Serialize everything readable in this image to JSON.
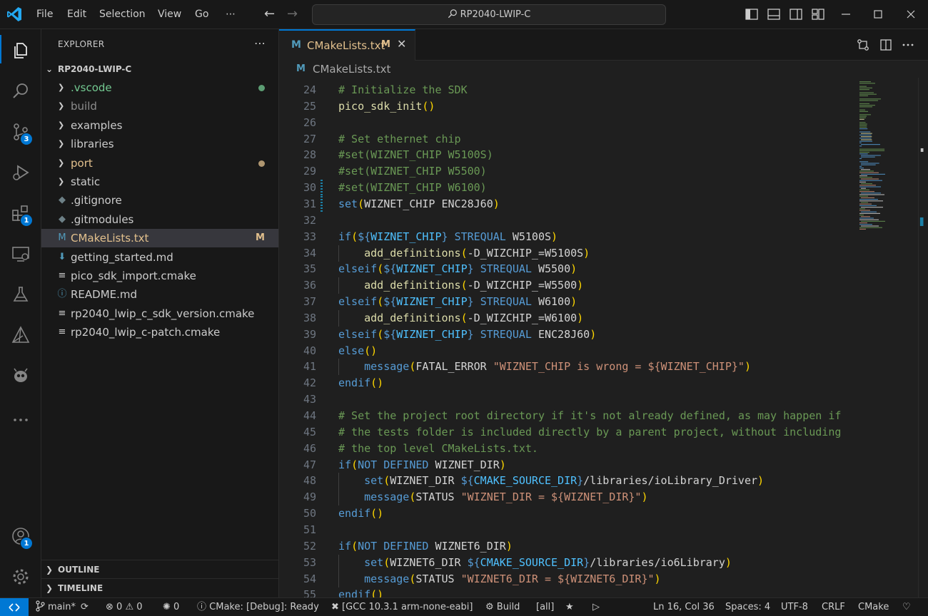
{
  "titlebar": {
    "menus": [
      "File",
      "Edit",
      "Selection",
      "View",
      "Go",
      "⋯"
    ],
    "search_text": "RP2040-LWIP-C",
    "search_icon": "search-icon",
    "accent": "#0078d4"
  },
  "activity_bar": {
    "badges": {
      "source_control": "3",
      "extensions": "1",
      "accounts": "1"
    }
  },
  "sidebar": {
    "title": "EXPLORER",
    "more": "⋯",
    "root": "RP2040-LWIP-C",
    "items": [
      {
        "name": ".vscode",
        "type": "folder",
        "color": "#73c991",
        "status": "dot"
      },
      {
        "name": "build",
        "type": "folder",
        "color": "#8c8c8c",
        "status": ""
      },
      {
        "name": "examples",
        "type": "folder",
        "color": "#cccccc",
        "status": ""
      },
      {
        "name": "libraries",
        "type": "folder",
        "color": "#cccccc",
        "status": ""
      },
      {
        "name": "port",
        "type": "folder",
        "color": "#e2c08d",
        "status": "dot"
      },
      {
        "name": "static",
        "type": "folder",
        "color": "#cccccc",
        "status": ""
      },
      {
        "name": ".gitignore",
        "type": "file",
        "icon": "◆",
        "iconColor": "#6d8086",
        "color": "#cccccc"
      },
      {
        "name": ".gitmodules",
        "type": "file",
        "icon": "◆",
        "iconColor": "#6d8086",
        "color": "#cccccc"
      },
      {
        "name": "CMakeLists.txt",
        "type": "file",
        "icon": "M",
        "iconColor": "#519aba",
        "color": "#e2c08d",
        "mark": "M",
        "selected": true
      },
      {
        "name": "getting_started.md",
        "type": "file",
        "icon": "⬇",
        "iconColor": "#519aba",
        "color": "#cccccc"
      },
      {
        "name": "pico_sdk_import.cmake",
        "type": "file",
        "icon": "≡",
        "iconColor": "#cccccc",
        "color": "#cccccc"
      },
      {
        "name": "README.md",
        "type": "file",
        "icon": "ⓘ",
        "iconColor": "#519aba",
        "color": "#cccccc"
      },
      {
        "name": "rp2040_lwip_c_sdk_version.cmake",
        "type": "file",
        "icon": "≡",
        "iconColor": "#cccccc",
        "color": "#cccccc"
      },
      {
        "name": "rp2040_lwip_c-patch.cmake",
        "type": "file",
        "icon": "≡",
        "iconColor": "#cccccc",
        "color": "#cccccc"
      }
    ],
    "outline": "OUTLINE",
    "timeline": "TIMELINE"
  },
  "editor": {
    "tab": {
      "icon": "M",
      "label": "CMakeLists.txt",
      "modified": "M",
      "close": "✕"
    },
    "breadcrumb": {
      "icon": "M",
      "label": "CMakeLists.txt"
    },
    "current_line": 16,
    "modified_lines": [
      30,
      31
    ],
    "lines": [
      {
        "n": 24,
        "t": [
          [
            "cmt",
            "# Initialize the SDK"
          ]
        ]
      },
      {
        "n": 25,
        "t": [
          [
            "fn",
            "pico_sdk_init"
          ],
          [
            "par",
            "()"
          ]
        ]
      },
      {
        "n": 26,
        "t": []
      },
      {
        "n": 27,
        "t": [
          [
            "cmt",
            "# Set ethernet chip"
          ]
        ]
      },
      {
        "n": 28,
        "t": [
          [
            "cmt",
            "#set(WIZNET_CHIP W5100S)"
          ]
        ]
      },
      {
        "n": 29,
        "t": [
          [
            "cmt",
            "#set(WIZNET_CHIP W5500)"
          ]
        ]
      },
      {
        "n": 30,
        "t": [
          [
            "cmt",
            "#set(WIZNET_CHIP W6100)"
          ]
        ]
      },
      {
        "n": 31,
        "t": [
          [
            "kw",
            "set"
          ],
          [
            "par",
            "("
          ],
          [
            "plain",
            "WIZNET_CHIP ENC28J60"
          ],
          [
            "par",
            ")"
          ]
        ]
      },
      {
        "n": 32,
        "t": []
      },
      {
        "n": 33,
        "t": [
          [
            "kw",
            "if"
          ],
          [
            "par",
            "("
          ],
          [
            "kw",
            "${"
          ],
          [
            "var",
            "WIZNET_CHIP"
          ],
          [
            "kw",
            "}"
          ],
          [
            "plain",
            " "
          ],
          [
            "kw",
            "STREQUAL"
          ],
          [
            "plain",
            " W5100S"
          ],
          [
            "par",
            ")"
          ]
        ]
      },
      {
        "n": 34,
        "i": 1,
        "t": [
          [
            "fn",
            "add_definitions"
          ],
          [
            "par",
            "("
          ],
          [
            "plain",
            "-D_WIZCHIP_=W5100S"
          ],
          [
            "par",
            ")"
          ]
        ]
      },
      {
        "n": 35,
        "t": [
          [
            "kw",
            "elseif"
          ],
          [
            "par",
            "("
          ],
          [
            "kw",
            "${"
          ],
          [
            "var",
            "WIZNET_CHIP"
          ],
          [
            "kw",
            "}"
          ],
          [
            "plain",
            " "
          ],
          [
            "kw",
            "STREQUAL"
          ],
          [
            "plain",
            " W5500"
          ],
          [
            "par",
            ")"
          ]
        ]
      },
      {
        "n": 36,
        "i": 1,
        "t": [
          [
            "fn",
            "add_definitions"
          ],
          [
            "par",
            "("
          ],
          [
            "plain",
            "-D_WIZCHIP_=W5500"
          ],
          [
            "par",
            ")"
          ]
        ]
      },
      {
        "n": 37,
        "t": [
          [
            "kw",
            "elseif"
          ],
          [
            "par",
            "("
          ],
          [
            "kw",
            "${"
          ],
          [
            "var",
            "WIZNET_CHIP"
          ],
          [
            "kw",
            "}"
          ],
          [
            "plain",
            " "
          ],
          [
            "kw",
            "STREQUAL"
          ],
          [
            "plain",
            " W6100"
          ],
          [
            "par",
            ")"
          ]
        ]
      },
      {
        "n": 38,
        "i": 1,
        "t": [
          [
            "fn",
            "add_definitions"
          ],
          [
            "par",
            "("
          ],
          [
            "plain",
            "-D_WIZCHIP_=W6100"
          ],
          [
            "par",
            ")"
          ]
        ]
      },
      {
        "n": 39,
        "t": [
          [
            "kw",
            "elseif"
          ],
          [
            "par",
            "("
          ],
          [
            "kw",
            "${"
          ],
          [
            "var",
            "WIZNET_CHIP"
          ],
          [
            "kw",
            "}"
          ],
          [
            "plain",
            " "
          ],
          [
            "kw",
            "STREQUAL"
          ],
          [
            "plain",
            " ENC28J60"
          ],
          [
            "par",
            ")"
          ]
        ]
      },
      {
        "n": 40,
        "t": [
          [
            "kw",
            "else"
          ],
          [
            "par",
            "()"
          ]
        ]
      },
      {
        "n": 41,
        "i": 1,
        "t": [
          [
            "kw",
            "message"
          ],
          [
            "par",
            "("
          ],
          [
            "plain",
            "FATAL_ERROR "
          ],
          [
            "str",
            "\"WIZNET_CHIP is wrong = ${WIZNET_CHIP}\""
          ],
          [
            "par",
            ")"
          ]
        ]
      },
      {
        "n": 42,
        "t": [
          [
            "kw",
            "endif"
          ],
          [
            "par",
            "()"
          ]
        ]
      },
      {
        "n": 43,
        "t": []
      },
      {
        "n": 44,
        "t": [
          [
            "cmt",
            "# Set the project root directory if it's not already defined, as may happen if"
          ]
        ]
      },
      {
        "n": 45,
        "t": [
          [
            "cmt",
            "# the tests folder is included directly by a parent project, without including"
          ]
        ]
      },
      {
        "n": 46,
        "t": [
          [
            "cmt",
            "# the top level CMakeLists.txt."
          ]
        ]
      },
      {
        "n": 47,
        "t": [
          [
            "kw",
            "if"
          ],
          [
            "par",
            "("
          ],
          [
            "kw",
            "NOT DEFINED"
          ],
          [
            "plain",
            " WIZNET_DIR"
          ],
          [
            "par",
            ")"
          ]
        ]
      },
      {
        "n": 48,
        "i": 1,
        "t": [
          [
            "kw",
            "set"
          ],
          [
            "par",
            "("
          ],
          [
            "plain",
            "WIZNET_DIR "
          ],
          [
            "kw",
            "${"
          ],
          [
            "var",
            "CMAKE_SOURCE_DIR"
          ],
          [
            "kw",
            "}"
          ],
          [
            "plain",
            "/libraries/ioLibrary_Driver"
          ],
          [
            "par",
            ")"
          ]
        ]
      },
      {
        "n": 49,
        "i": 1,
        "t": [
          [
            "kw",
            "message"
          ],
          [
            "par",
            "("
          ],
          [
            "plain",
            "STATUS "
          ],
          [
            "str",
            "\"WIZNET_DIR = ${WIZNET_DIR}\""
          ],
          [
            "par",
            ")"
          ]
        ]
      },
      {
        "n": 50,
        "t": [
          [
            "kw",
            "endif"
          ],
          [
            "par",
            "()"
          ]
        ]
      },
      {
        "n": 51,
        "t": []
      },
      {
        "n": 52,
        "t": [
          [
            "kw",
            "if"
          ],
          [
            "par",
            "("
          ],
          [
            "kw",
            "NOT DEFINED"
          ],
          [
            "plain",
            " WIZNET6_DIR"
          ],
          [
            "par",
            ")"
          ]
        ]
      },
      {
        "n": 53,
        "i": 1,
        "t": [
          [
            "kw",
            "set"
          ],
          [
            "par",
            "("
          ],
          [
            "plain",
            "WIZNET6_DIR "
          ],
          [
            "kw",
            "${"
          ],
          [
            "var",
            "CMAKE_SOURCE_DIR"
          ],
          [
            "kw",
            "}"
          ],
          [
            "plain",
            "/libraries/io6Library"
          ],
          [
            "par",
            ")"
          ]
        ]
      },
      {
        "n": 54,
        "i": 1,
        "t": [
          [
            "kw",
            "message"
          ],
          [
            "par",
            "("
          ],
          [
            "plain",
            "STATUS "
          ],
          [
            "str",
            "\"WIZNET6_DIR = ${WIZNET6_DIR}\""
          ],
          [
            "par",
            ")"
          ]
        ]
      },
      {
        "n": 55,
        "t": [
          [
            "kw",
            "endif"
          ],
          [
            "par",
            "()"
          ]
        ]
      }
    ]
  },
  "statusbar": {
    "branch": "main*",
    "errors": "0",
    "warnings": "0",
    "ports": "0",
    "cmake_status": "CMake: [Debug]: Ready",
    "kit": "[GCC 10.3.1 arm-none-eabi]",
    "build": "Build",
    "target": "[all]",
    "position": "Ln 16, Col 36",
    "spaces": "Spaces: 4",
    "encoding": "UTF-8",
    "eol": "CRLF",
    "language": "CMake"
  }
}
